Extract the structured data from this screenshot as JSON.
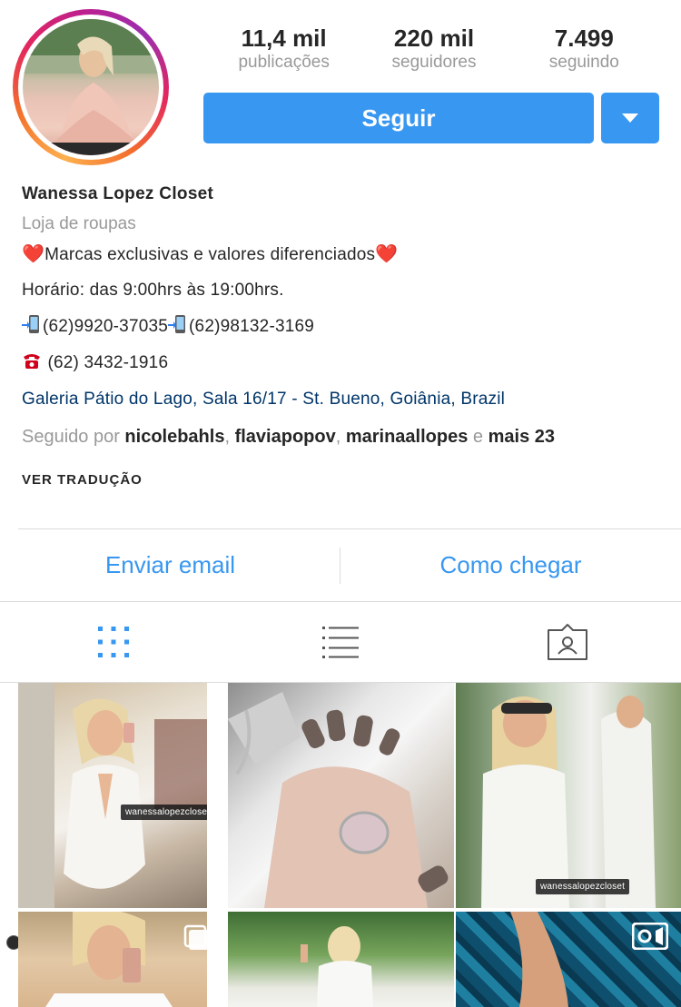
{
  "profile": {
    "stats": [
      {
        "value": "11,4 mil",
        "label": "publicações"
      },
      {
        "value": "220 mil",
        "label": "seguidores"
      },
      {
        "value": "7.499",
        "label": "seguindo"
      }
    ],
    "follow_label": "Seguir"
  },
  "bio": {
    "name": "Wanessa Lopez Closet",
    "category": "Loja de roupas",
    "line1": "Marcas exclusivas e valores diferenciados",
    "line2": "Horário: das 9:00hrs às 19:00hrs.",
    "phone1": "(62)9920-37035",
    "phone2": "(62)98132-3169",
    "phone3": " (62) 3432-1916",
    "address": "Galeria Pátio do Lago, Sala 16/17 - St. Bueno, Goiânia, Brazil",
    "followed_prefix": "Seguido por ",
    "followers": [
      "nicolebahls",
      "flaviapopov",
      "marinaallopes"
    ],
    "followed_and": " e ",
    "followed_more": "mais 23",
    "translate": "VER TRADUÇÃO"
  },
  "contact": {
    "email": "Enviar email",
    "directions": "Como chegar"
  },
  "tabs": {
    "grid_icon": "grid-icon",
    "list_icon": "list-icon",
    "tagged_icon": "tagged-icon"
  },
  "posts": {
    "watermark": "wanessalopezcloset"
  },
  "colors": {
    "accent": "#3897f0",
    "link_dark": "#003569",
    "muted": "#999999",
    "heart": "#e0245e"
  }
}
